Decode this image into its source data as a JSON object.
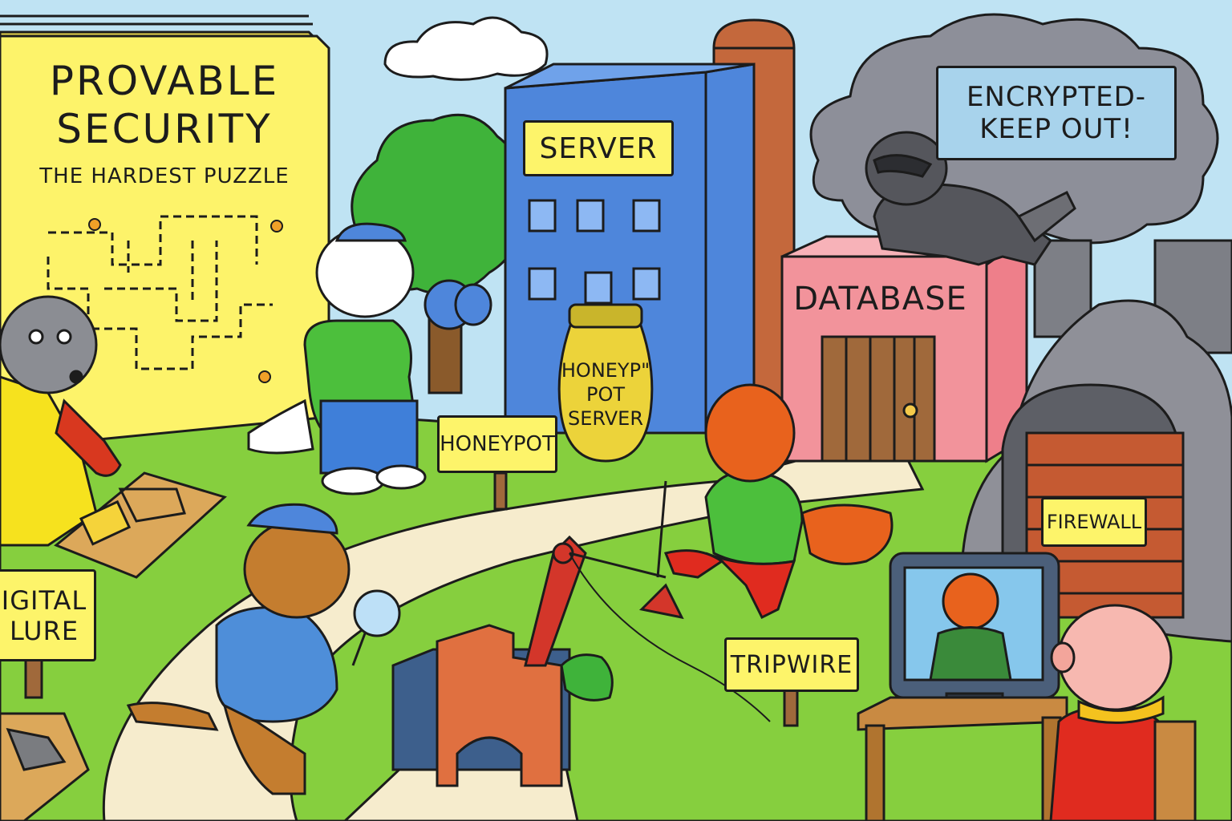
{
  "book": {
    "title_line1": "PROVABLE",
    "title_line2": "SECURITY",
    "subtitle": "THE HARDEST PUZZLE"
  },
  "signs": {
    "server": "SERVER",
    "encrypted_line1": "ENCRYPTED-",
    "encrypted_line2": "KEEP OUT!",
    "database": "DATABASE",
    "honeypot_jar_line1": "HONEYP\"",
    "honeypot_jar_line2": "POT",
    "honeypot_jar_line3": "SERVER",
    "honeypot": "HONEYPOT",
    "digital_lure_line1": "IGITAL",
    "digital_lure_line2": "LURE",
    "tripwire": "TRIPWIRE",
    "firewall": "FIREWALL"
  },
  "colors": {
    "sky": "#bfe3f3",
    "grass": "#86cf3e",
    "book_yellow": "#fdf36a",
    "server_blue": "#4e86db",
    "database_pink": "#f2939b",
    "cloud_gray": "#8d8f99",
    "sign_yellow": "#fdf46a",
    "fox_orange": "#e8621d",
    "path": "#f6eccd"
  }
}
